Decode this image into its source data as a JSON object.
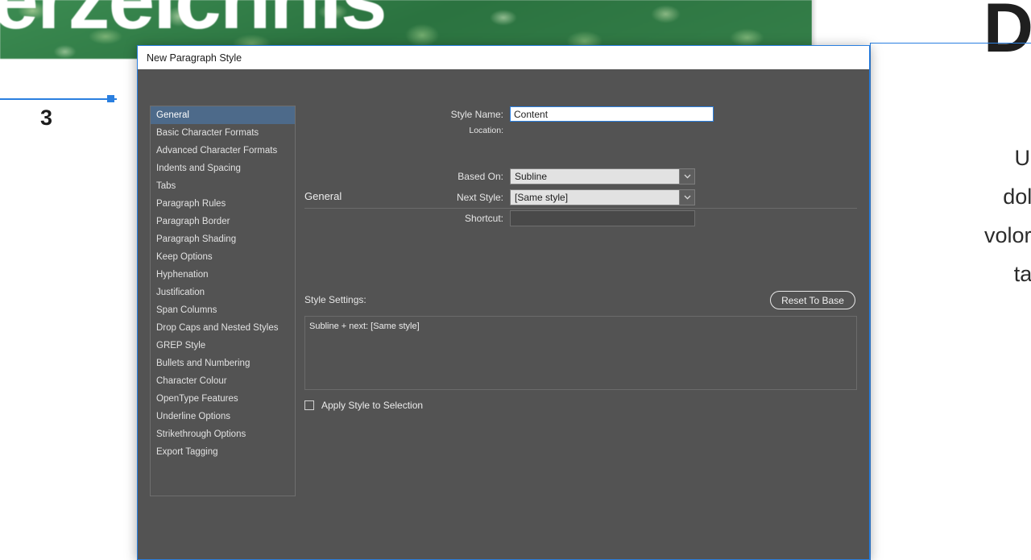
{
  "document": {
    "hero_headline": "erzeichnis",
    "page_number": "3",
    "right_big_letter": "D",
    "right_body_lines": [
      "Ullisqu",
      "dolum sa",
      "volorrumquia",
      "ta tqua"
    ],
    "accent_guide_color": "#2a7fe0",
    "grass_color": "#2b7340"
  },
  "dialog": {
    "title": "New Paragraph Style",
    "accent_color": "#2a7fe0",
    "background_color": "#535353",
    "selected_color": "#4d6a8a",
    "categories": [
      {
        "label": "General",
        "selected": true
      },
      {
        "label": "Basic Character Formats",
        "selected": false
      },
      {
        "label": "Advanced Character Formats",
        "selected": false
      },
      {
        "label": "Indents and Spacing",
        "selected": false
      },
      {
        "label": "Tabs",
        "selected": false
      },
      {
        "label": "Paragraph Rules",
        "selected": false
      },
      {
        "label": "Paragraph Border",
        "selected": false
      },
      {
        "label": "Paragraph Shading",
        "selected": false
      },
      {
        "label": "Keep Options",
        "selected": false
      },
      {
        "label": "Hyphenation",
        "selected": false
      },
      {
        "label": "Justification",
        "selected": false
      },
      {
        "label": "Span Columns",
        "selected": false
      },
      {
        "label": "Drop Caps and Nested Styles",
        "selected": false
      },
      {
        "label": "GREP Style",
        "selected": false
      },
      {
        "label": "Bullets and Numbering",
        "selected": false
      },
      {
        "label": "Character Colour",
        "selected": false
      },
      {
        "label": "OpenType Features",
        "selected": false
      },
      {
        "label": "Underline Options",
        "selected": false
      },
      {
        "label": "Strikethrough Options",
        "selected": false
      },
      {
        "label": "Export Tagging",
        "selected": false
      }
    ],
    "form": {
      "style_name_label": "Style Name:",
      "style_name_value": "Content",
      "style_name_placeholder": "",
      "location_label": "Location:",
      "location_value": "",
      "section_heading": "General",
      "based_on_label": "Based On:",
      "based_on_value": "Subline",
      "next_style_label": "Next Style:",
      "next_style_value": "[Same style]",
      "shortcut_label": "Shortcut:",
      "shortcut_value": "",
      "shortcut_placeholder": "",
      "settings_label": "Style Settings:",
      "reset_button": "Reset To Base",
      "settings_text": "Subline + next: [Same style]",
      "apply_checkbox_label": "Apply Style to Selection",
      "apply_checkbox_checked": false,
      "dropdown_icon": "chevron-down-icon"
    }
  }
}
